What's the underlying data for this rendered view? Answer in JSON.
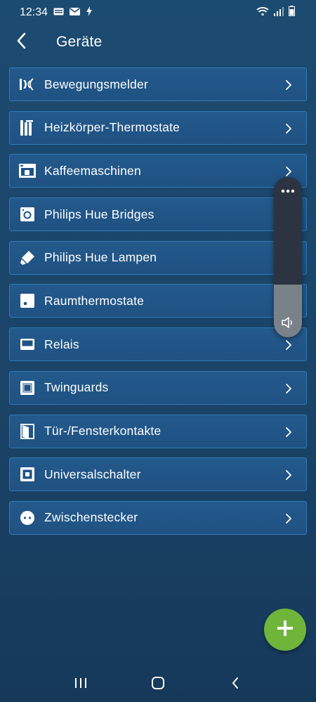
{
  "status_bar": {
    "time": "12:34"
  },
  "header": {
    "title": "Geräte"
  },
  "devices": [
    {
      "label": "Bewegungsmelder",
      "icon": "motion-sensor-icon"
    },
    {
      "label": "Heizkörper-Thermostate",
      "icon": "radiator-icon"
    },
    {
      "label": "Kaffeemaschinen",
      "icon": "coffee-machine-icon"
    },
    {
      "label": "Philips Hue Bridges",
      "icon": "hue-bridge-icon"
    },
    {
      "label": "Philips Hue Lampen",
      "icon": "lamp-icon"
    },
    {
      "label": "Raumthermostate",
      "icon": "room-thermostat-icon"
    },
    {
      "label": "Relais",
      "icon": "relay-icon"
    },
    {
      "label": "Twinguards",
      "icon": "twinguard-icon"
    },
    {
      "label": "Tür-/Fensterkontakte",
      "icon": "door-window-contact-icon"
    },
    {
      "label": "Universalschalter",
      "icon": "universal-switch-icon"
    },
    {
      "label": "Zwischenstecker",
      "icon": "plug-icon"
    }
  ],
  "volume": {
    "level_fraction": 0.33
  },
  "colors": {
    "background": "#1c4b71",
    "item_border": "#2f7bb8",
    "fab": "#6fb53a"
  }
}
